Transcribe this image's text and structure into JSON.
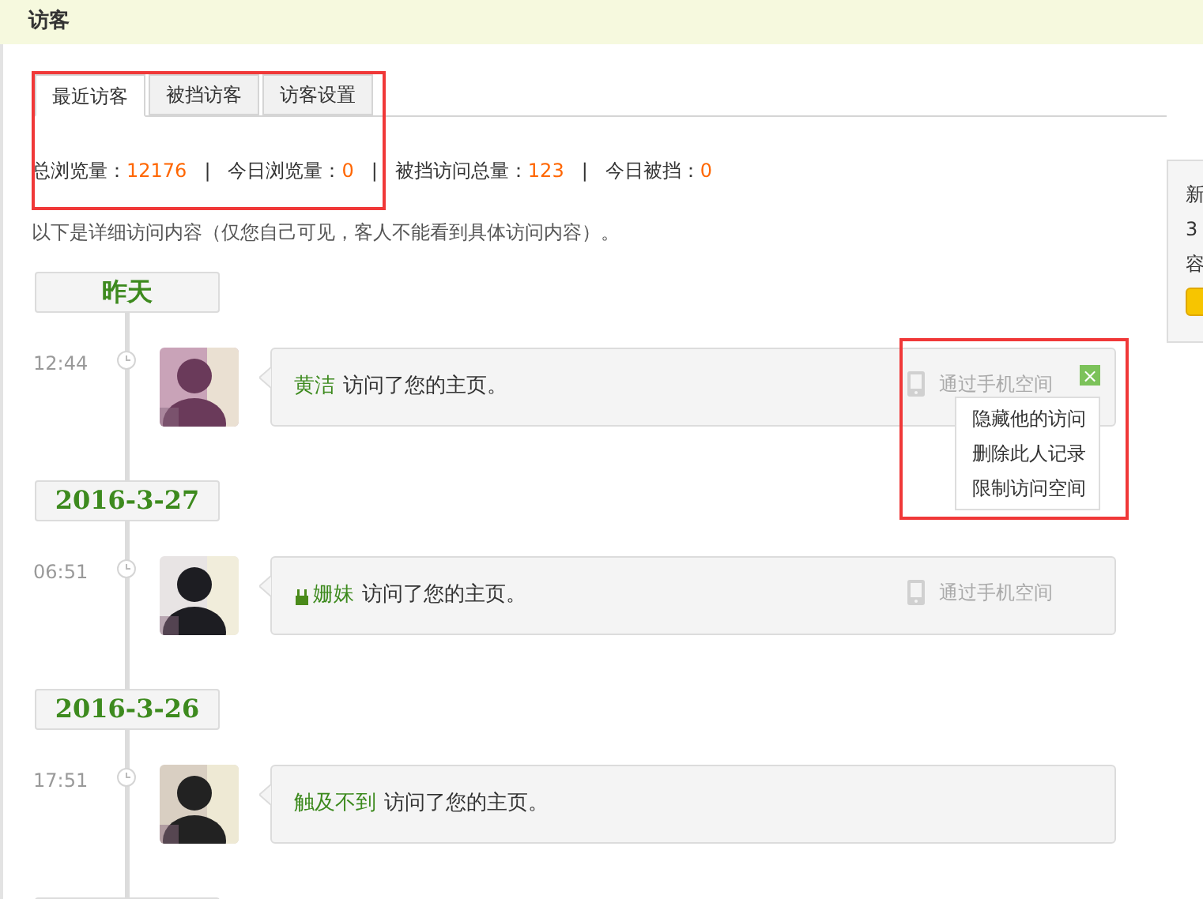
{
  "header": {
    "title": "访客"
  },
  "tabs": [
    {
      "label": "最近访客",
      "selected": true
    },
    {
      "label": "被挡访客",
      "selected": false
    },
    {
      "label": "访客设置",
      "selected": false
    }
  ],
  "stats": {
    "highlighted": true,
    "separator": "|",
    "items": [
      {
        "label": "总浏览量：",
        "value": "12176"
      },
      {
        "label": "今日浏览量：",
        "value": "0"
      },
      {
        "label": "被挡访问总量：",
        "value": "123"
      },
      {
        "label": "今日被挡：",
        "value": "0"
      }
    ]
  },
  "note": "以下是详细访问内容（仅您自己可见，客人不能看到具体访问内容）。",
  "timeline": [
    {
      "date": "昨天",
      "visits": [
        {
          "time": "12:44",
          "name": "黄洁",
          "action": "访问了您的主页。",
          "badge": false,
          "via": "通过手机空间",
          "menu_open": true,
          "highlighted": true,
          "menu": [
            "隐藏他的访问",
            "删除此人记录",
            "限制访问空间"
          ],
          "close": "×"
        }
      ]
    },
    {
      "date": "2016-3-27",
      "visits": [
        {
          "time": "06:51",
          "name": "姗妹",
          "action": "访问了您的主页。",
          "badge": true,
          "via": "通过手机空间",
          "menu_open": false
        }
      ]
    },
    {
      "date": "2016-3-26",
      "visits": [
        {
          "time": "17:51",
          "name": "触及不到",
          "action": "访问了您的主页。",
          "badge": false,
          "menu_open": false
        }
      ]
    }
  ],
  "side_panel": {
    "lines": [
      "新",
      "3",
      "容"
    ]
  }
}
